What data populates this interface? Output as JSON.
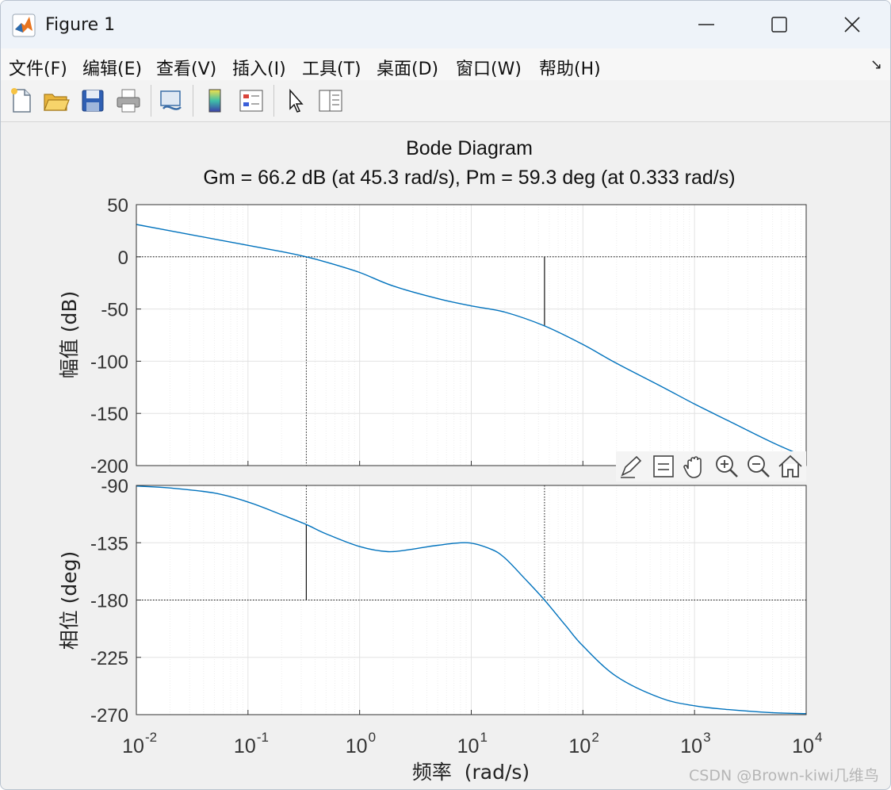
{
  "window": {
    "title": "Figure 1",
    "minimize_icon": "minimize-icon",
    "maximize_icon": "maximize-icon",
    "close_icon": "close-icon"
  },
  "menu": {
    "items": [
      "文件(F)",
      "编辑(E)",
      "查看(V)",
      "插入(I)",
      "工具(T)",
      "桌面(D)",
      "窗口(W)",
      "帮助(H)"
    ],
    "dock_icon": "dock-arrow-icon"
  },
  "toolbar": {
    "icons": [
      "new-figure-icon",
      "open-file-icon",
      "save-icon",
      "print-icon",
      "link-plot-icon",
      "colorbar-icon",
      "legend-icon",
      "edit-plot-icon",
      "property-inspector-icon"
    ]
  },
  "axes_toolbar": {
    "icons": [
      "brush-icon",
      "data-tips-icon",
      "pan-icon",
      "zoom-in-icon",
      "zoom-out-icon",
      "home-icon"
    ]
  },
  "watermark": "CSDN @Brown-kiwi几维鸟",
  "colors": {
    "curve": "#0072bd",
    "grid": "#e2e2e2",
    "axes_bg": "#ffffff",
    "figure_bg": "#f0f0f0"
  },
  "chart_data": [
    {
      "type": "line",
      "title": "Bode Diagram",
      "subtitle": "Gm = 66.2 dB (at 45.3 rad/s),  Pm = 59.3 deg (at 0.333 rad/s)",
      "ylabel": "幅值 (dB)",
      "xscale": "log",
      "xlim": [
        0.01,
        10000
      ],
      "ylim": [
        -200,
        50
      ],
      "yticks": [
        "50",
        "0",
        "-50",
        "-100",
        "-150",
        "-200"
      ],
      "grid": true,
      "series": [
        {
          "x": [
            0.01,
            0.02,
            0.05,
            0.1,
            0.2,
            0.333,
            0.5,
            1,
            2,
            5,
            10,
            20,
            45.3,
            100,
            200,
            500,
            1000,
            2000,
            5000,
            10000
          ],
          "y": [
            31,
            25,
            17,
            11,
            5,
            0,
            -5,
            -15,
            -28,
            -40,
            -47,
            -53,
            -66.2,
            -84,
            -102,
            -124,
            -141,
            -157,
            -178,
            -192
          ]
        }
      ],
      "markers": [
        {
          "label": "Pm reference",
          "x": 0.333,
          "y": 0
        },
        {
          "label": "Gm",
          "x": 45.3,
          "y_from": 0,
          "y_to": -66.2
        }
      ]
    },
    {
      "type": "line",
      "ylabel": "相位 (deg)",
      "xlabel": "频率  (rad/s)",
      "xscale": "log",
      "xlim": [
        0.01,
        10000
      ],
      "ylim": [
        -270,
        -90
      ],
      "yticks": [
        "-90",
        "-135",
        "-180",
        "-225",
        "-270"
      ],
      "xticks": [
        {
          "base": "10",
          "exp": "-2"
        },
        {
          "base": "10",
          "exp": "-1"
        },
        {
          "base": "10",
          "exp": "0"
        },
        {
          "base": "10",
          "exp": "1"
        },
        {
          "base": "10",
          "exp": "2"
        },
        {
          "base": "10",
          "exp": "3"
        },
        {
          "base": "10",
          "exp": "4"
        }
      ],
      "grid": true,
      "series": [
        {
          "x": [
            0.01,
            0.02,
            0.05,
            0.1,
            0.2,
            0.333,
            0.5,
            1,
            1.8,
            3,
            5,
            9.3,
            15,
            20,
            30,
            45.3,
            70,
            100,
            200,
            500,
            1000,
            2000,
            5000,
            10000
          ],
          "y": [
            -90.5,
            -92,
            -96,
            -103,
            -113,
            -120.7,
            -128,
            -138,
            -142,
            -140,
            -137,
            -135,
            -140,
            -147,
            -163,
            -180,
            -200,
            -216,
            -240,
            -257,
            -263,
            -266,
            -268.5,
            -269.2
          ]
        }
      ],
      "markers": [
        {
          "label": "Pm",
          "x": 0.333,
          "y_from": -180,
          "y_to": -120.7
        },
        {
          "label": "Gm reference",
          "x": 45.3,
          "y": -180
        }
      ]
    }
  ]
}
